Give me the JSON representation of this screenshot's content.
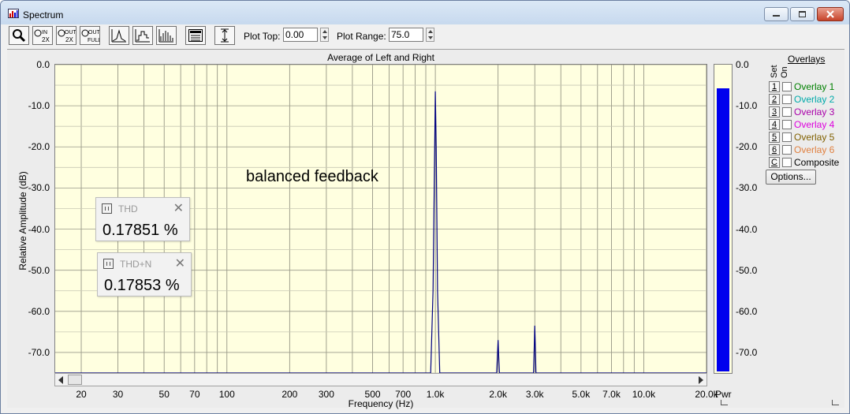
{
  "window": {
    "title": "Spectrum"
  },
  "toolbar": {
    "buttons": [
      "zoom-icon",
      "zoom-in-2x-icon",
      "zoom-out-2x-icon",
      "zoom-out-full-icon",
      "line-graph-icon",
      "step-graph-icon",
      "bar-graph-icon",
      "legend-icon",
      "vertical-range-icon"
    ],
    "plot_top_label": "Plot Top:",
    "plot_top_value": "0.00",
    "plot_range_label": "Plot Range:",
    "plot_range_value": "75.0"
  },
  "plot": {
    "title": "Average of Left and Right",
    "annotation": "balanced feedback"
  },
  "readouts": {
    "thd": {
      "title": "THD",
      "value": "0.17851 %"
    },
    "thdn": {
      "title": "THD+N",
      "value": "0.17853 %"
    }
  },
  "meter": {
    "label": "Pwr",
    "level_db": -5.8,
    "fill_color": "#0000ee",
    "ticks": [
      "0.0",
      "-10.0",
      "-20.0",
      "-30.0",
      "-40.0",
      "-50.0",
      "-60.0",
      "-70.0"
    ]
  },
  "overlays": {
    "title": "Overlays",
    "set_header": "Set",
    "on_header": "On",
    "items": [
      {
        "num": "1",
        "name": "Overlay 1",
        "color": "#008000"
      },
      {
        "num": "2",
        "name": "Overlay 2",
        "color": "#00aaaa"
      },
      {
        "num": "3",
        "name": "Overlay 3",
        "color": "#aa00aa"
      },
      {
        "num": "4",
        "name": "Overlay 4",
        "color": "#dd00dd"
      },
      {
        "num": "5",
        "name": "Overlay 5",
        "color": "#806000"
      },
      {
        "num": "6",
        "name": "Overlay 6",
        "color": "#e08040"
      },
      {
        "num": "C",
        "name": "Composite",
        "color": "#000000"
      }
    ],
    "options_label": "Options..."
  },
  "chart_data": {
    "type": "line",
    "title": "Average of Left and Right",
    "xlabel": "Frequency (Hz)",
    "ylabel": "Relative Amplitude (dB)",
    "x_scale": "log",
    "xlim": [
      15,
      20000
    ],
    "ylim": [
      -75,
      0
    ],
    "grid": true,
    "line_color": "#000080",
    "background": "#ffffe0",
    "x_tick_labels": [
      "20",
      "30",
      "50",
      "70",
      "100",
      "200",
      "300",
      "500",
      "700",
      "1.0k",
      "2.0k",
      "3.0k",
      "5.0k",
      "7.0k",
      "10.0k",
      "20.0k"
    ],
    "x_tick_values": [
      20,
      30,
      50,
      70,
      100,
      200,
      300,
      500,
      700,
      1000,
      2000,
      3000,
      5000,
      7000,
      10000,
      20000
    ],
    "y_tick_labels": [
      "0.0",
      "-10.0",
      "-20.0",
      "-30.0",
      "-40.0",
      "-50.0",
      "-60.0",
      "-70.0"
    ],
    "y_tick_values": [
      0,
      -10,
      -20,
      -30,
      -40,
      -50,
      -60,
      -70
    ],
    "series": [
      {
        "x": [
          15,
          950,
          975,
          990,
          1000,
          1010,
          1025,
          1050,
          1970,
          1985,
          2000,
          2015,
          2030,
          2960,
          2980,
          3000,
          3020,
          3040,
          20000
        ],
        "y": [
          -75,
          -75,
          -55,
          -25,
          -6.5,
          -20,
          -55,
          -75,
          -75,
          -71,
          -67,
          -71,
          -75,
          -75,
          -69,
          -63.5,
          -69,
          -75,
          -75
        ]
      }
    ]
  }
}
